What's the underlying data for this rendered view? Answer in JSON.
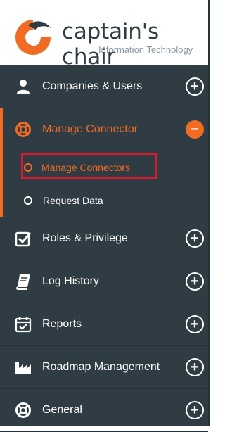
{
  "brand": {
    "name": "captain's chair",
    "tagline": "Information Technology"
  },
  "colors": {
    "sidebar_bg": "#2f3c44",
    "accent": "#f26b22",
    "highlight": "#e0182d"
  },
  "menu": {
    "items": [
      {
        "label": "Companies & Users",
        "icon": "user-icon",
        "toggle": "+"
      },
      {
        "label": "Manage Connector",
        "icon": "life-ring-icon",
        "toggle": "−",
        "expanded": true
      },
      {
        "label": "Roles & Privilege",
        "icon": "check-square-icon",
        "toggle": "+"
      },
      {
        "label": "Log History",
        "icon": "book-icon",
        "toggle": "+"
      },
      {
        "label": "Reports",
        "icon": "calendar-check-icon",
        "toggle": "+"
      },
      {
        "label": "Roadmap Management",
        "icon": "industry-icon",
        "toggle": "+"
      },
      {
        "label": "General",
        "icon": "life-ring-icon",
        "toggle": "+"
      }
    ],
    "submenu": [
      {
        "label": "Manage Connectors",
        "current": true
      },
      {
        "label": "Request Data"
      }
    ]
  }
}
